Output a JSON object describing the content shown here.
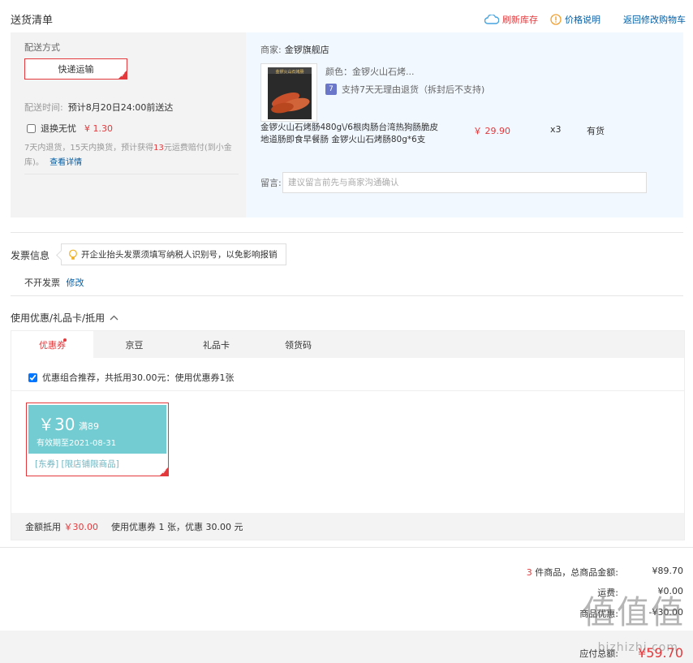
{
  "header": {
    "title": "送货清单",
    "refresh_stock": "刷新库存",
    "price_info": "价格说明",
    "back_to_cart": "返回修改购物车"
  },
  "shipping": {
    "label": "配送方式",
    "method": "快递运输",
    "time_label": "配送时间:",
    "time_value": "预计8月20日24:00前送达",
    "swap_label": "退换无忧",
    "swap_price": "¥ 1.30",
    "swap_desc_pre": "7天内退货，15天内换货，预计获得",
    "swap_desc_num": "13",
    "swap_desc_post": "元运费赔付(到小金库)。",
    "swap_more": "查看详情"
  },
  "product": {
    "merchant_label": "商家:",
    "merchant_name": "金锣旗舰店",
    "color": "颜色：金锣火山石烤...",
    "return_badge": "7",
    "return_policy": "支持7天无理由退货（拆封后不支持)",
    "name": "金锣火山石烤肠480g\\/6根肉肠台湾热狗肠脆皮地道肠即食早餐肠 金锣火山石烤肠80g*6支",
    "price": "￥ 29.90",
    "qty": "x3",
    "stock": "有货",
    "msg_label": "留言:",
    "msg_placeholder": "建议留言前先与商家沟通确认",
    "img_text": "金锣火山石烤肠"
  },
  "invoice": {
    "title": "发票信息",
    "tip": "开企业抬头发票须填写纳税人识别号，以免影响报销",
    "state": "不开发票",
    "edit": "修改"
  },
  "coupon": {
    "title": "使用优惠/礼品卡/抵用",
    "tabs": [
      "优惠券",
      "京豆",
      "礼品卡",
      "领货码"
    ],
    "combo": "优惠组合推荐，共抵用30.00元：使用优惠券1张",
    "card": {
      "amount": "￥30",
      "threshold": "满89",
      "expiry": "有效期至2021-08-31",
      "tags": "[东券]  [限店铺限商品]"
    },
    "footer_label": "金额抵用",
    "footer_amount": "￥30.00",
    "footer_desc": "使用优惠券 1 张，优惠 30.00 元"
  },
  "summary": {
    "count": "3",
    "goods_label": "件商品，总商品金额:",
    "goods_value": "¥89.70",
    "freight_label": "运费:",
    "freight_value": "¥0.00",
    "discount_label": "商品优惠:",
    "discount_value": "-¥30.00",
    "payable_label": "应付总额:",
    "payable_value": "¥59.70"
  },
  "watermark": {
    "big": "值值值",
    "small": "bizhizhi.com"
  },
  "colors": {
    "accent": "#e4393c",
    "link": "#005ea7",
    "coupon": "#72ccd1"
  }
}
